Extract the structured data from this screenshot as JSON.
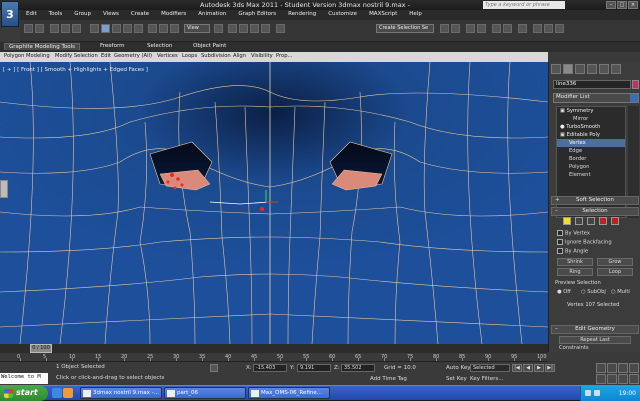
{
  "window": {
    "title": "Autodesk 3ds Max  2011  - Student Version    3dmax nostril 9.max  -",
    "search_placeholder": "Type a keyword or phrase",
    "logo": "3"
  },
  "menu": [
    "Edit",
    "Tools",
    "Group",
    "Views",
    "Create",
    "Modifiers",
    "Animation",
    "Graph Editors",
    "Rendering",
    "Customize",
    "MAXScript",
    "Help"
  ],
  "toolbar": {
    "view_dropdown": "View",
    "selection_set": "Create Selection Se"
  },
  "ribbon": {
    "tabs": [
      "Graphite Modeling Tools",
      "Freeform",
      "Selection",
      "Object Paint"
    ],
    "subtabs": [
      "Polygon Modeling",
      "Modify Selection",
      "Edit",
      "Geometry (All)",
      "Vertices",
      "Loops",
      "Subdivision",
      "Align",
      "Visibility",
      "Prop..."
    ]
  },
  "viewport": {
    "label": "[ + ] [ Front ] [ Smooth + Highlights + Edged Faces ]"
  },
  "command_panel": {
    "object_name": "line336",
    "modifier_list": "Modifier List",
    "stack": [
      {
        "label": "Symmetry",
        "level": 0,
        "type": "mod"
      },
      {
        "label": "Mirror",
        "level": 1,
        "type": "sub"
      },
      {
        "label": "TurboSmooth",
        "level": 0,
        "type": "mod"
      },
      {
        "label": "Editable Poly",
        "level": 0,
        "type": "mod"
      },
      {
        "label": "Vertex",
        "level": 1,
        "type": "selected"
      },
      {
        "label": "Edge",
        "level": 1,
        "type": "sub"
      },
      {
        "label": "Border",
        "level": 1,
        "type": "sub"
      },
      {
        "label": "Polygon",
        "level": 1,
        "type": "sub"
      },
      {
        "label": "Element",
        "level": 1,
        "type": "sub"
      }
    ],
    "soft_selection": "Soft Selection",
    "selection": "Selection",
    "by_vertex": "By Vertex",
    "ignore_backfacing": "Ignore Backfacing",
    "by_angle": "By Angle",
    "shrink": "Shrink",
    "grow": "Grow",
    "ring": "Ring",
    "loop": "Loop",
    "preview_selection": "Preview Selection",
    "preview_off": "Off",
    "preview_subobj": "SubObj",
    "preview_multi": "Multi",
    "selected_count": "Vertex 107 Selected",
    "edit_geometry": "Edit Geometry",
    "repeat_last": "Repeat Last",
    "constraints": "Constraints"
  },
  "timeline": {
    "frame": "0 / 100",
    "ticks": [
      "0",
      "5",
      "10",
      "15",
      "20",
      "25",
      "30",
      "35",
      "40",
      "45",
      "50",
      "55",
      "60",
      "65",
      "70",
      "75",
      "80",
      "85",
      "90",
      "95",
      "100"
    ]
  },
  "status": {
    "maxscript": "Welcome to M",
    "objects_selected": "1 Object Selected",
    "prompt": "Click or click-and-drag to select objects",
    "x_label": "X:",
    "x": "-15.403",
    "y_label": "Y:",
    "y": "9.191",
    "z_label": "Z:",
    "z": "35.502",
    "grid": "Grid = 10.0",
    "add_time_tag": "Add Time Tag",
    "auto_key": "Auto Key",
    "set_key": "Set Key",
    "selected": "Selected",
    "key_filters": "Key Filters..."
  },
  "taskbar": {
    "start": "start",
    "tasks": [
      "3dmax nostril 9.max -...",
      "part_06",
      "Max_OMS-06_Refine..."
    ],
    "clock": "19:00"
  },
  "colors": {
    "viewport_bg": "#173d7a",
    "wire": "#e8c9a0",
    "selected_face": "#d98a7a",
    "vertex_red": "#ff2020"
  }
}
